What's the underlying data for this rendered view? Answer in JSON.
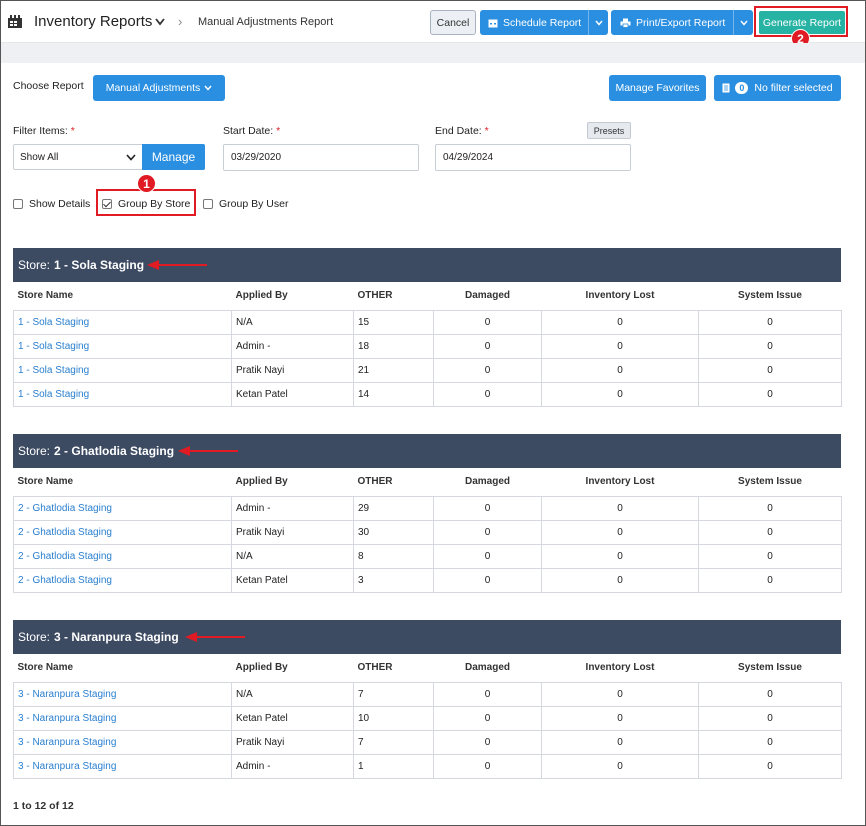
{
  "header": {
    "app_title": "Inventory Reports",
    "breadcrumb": "Manual Adjustments Report",
    "cancel_label": "Cancel",
    "schedule_label": "Schedule Report",
    "print_label": "Print/Export Report",
    "generate_label": "Generate Report",
    "callout_generate": "2"
  },
  "controls": {
    "choose_report_label": "Choose Report",
    "report_selected": "Manual Adjustments",
    "manage_favorites_label": "Manage Favorites",
    "filter_count": "0",
    "filter_status": "No filter selected",
    "filter_items_label": "Filter Items:",
    "required_mark": "*",
    "filter_items_value": "Show All",
    "manage_label": "Manage",
    "start_date_label": "Start Date:",
    "start_date_value": "03/29/2020",
    "end_date_label": "End Date:",
    "end_date_value": "04/29/2024",
    "presets_label": "Presets",
    "show_details_label": "Show Details",
    "show_details_checked": false,
    "group_by_store_label": "Group By Store",
    "group_by_store_checked": true,
    "group_by_user_label": "Group By User",
    "group_by_user_checked": false,
    "callout_group": "1"
  },
  "columns": [
    "Store Name",
    "Applied By",
    "OTHER",
    "Damaged",
    "Inventory Lost",
    "System Issue"
  ],
  "store_prefix": "Store:",
  "groups": [
    {
      "store": "1 - Sola Staging",
      "rows": [
        [
          "1 - Sola Staging",
          "N/A",
          "15",
          "0",
          "0",
          "0"
        ],
        [
          "1 - Sola Staging",
          "Admin -",
          "18",
          "0",
          "0",
          "0"
        ],
        [
          "1 - Sola Staging",
          "Pratik Nayi",
          "21",
          "0",
          "0",
          "0"
        ],
        [
          "1 - Sola Staging",
          "Ketan Patel",
          "14",
          "0",
          "0",
          "0"
        ]
      ]
    },
    {
      "store": "2 - Ghatlodia Staging",
      "rows": [
        [
          "2 - Ghatlodia Staging",
          "Admin -",
          "29",
          "0",
          "0",
          "0"
        ],
        [
          "2 - Ghatlodia Staging",
          "Pratik Nayi",
          "30",
          "0",
          "0",
          "0"
        ],
        [
          "2 - Ghatlodia Staging",
          "N/A",
          "8",
          "0",
          "0",
          "0"
        ],
        [
          "2 - Ghatlodia Staging",
          "Ketan Patel",
          "3",
          "0",
          "0",
          "0"
        ]
      ]
    },
    {
      "store": "3 - Naranpura Staging",
      "rows": [
        [
          "3 - Naranpura Staging",
          "N/A",
          "7",
          "0",
          "0",
          "0"
        ],
        [
          "3 - Naranpura Staging",
          "Ketan Patel",
          "10",
          "0",
          "0",
          "0"
        ],
        [
          "3 - Naranpura Staging",
          "Pratik Nayi",
          "7",
          "0",
          "0",
          "0"
        ],
        [
          "3 - Naranpura Staging",
          "Admin -",
          "1",
          "0",
          "0",
          "0"
        ]
      ]
    }
  ],
  "pagination": "1 to 12 of 12",
  "colors": {
    "primary": "#2a8fe0",
    "generate": "#26b3a3",
    "group_header": "#3c4a62",
    "annotation": "#e01b24",
    "link": "#2a7fd0"
  },
  "icons": [
    "report-icon",
    "chevron-down-icon",
    "chevron-right-icon",
    "calendar-icon",
    "printer-icon",
    "filter-list-icon",
    "checkbox-icon",
    "red-arrow-icon"
  ]
}
